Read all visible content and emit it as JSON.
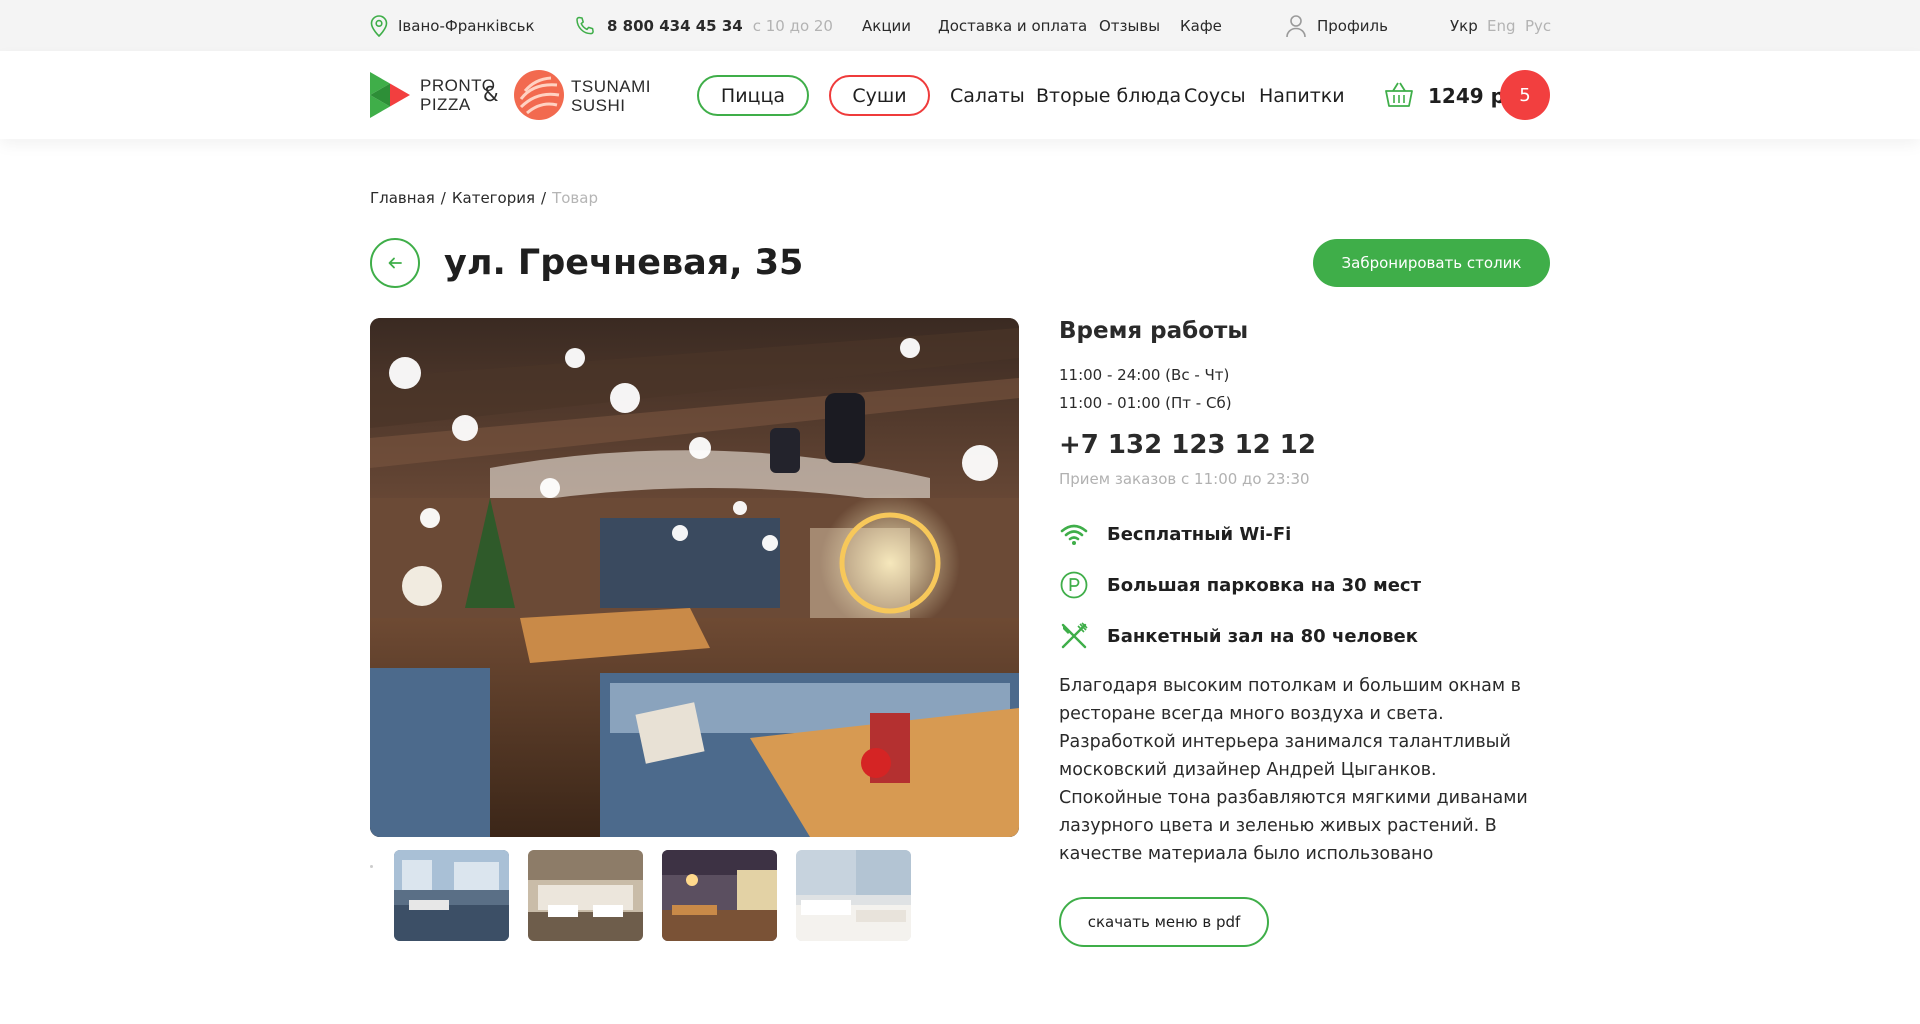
{
  "topbar": {
    "city": "Івано-Франківськ",
    "phone": "8 800 434 45 34",
    "phone_hours": "с 10 до 20",
    "links": [
      "Акции",
      "Доставка и оплата",
      "Отзывы",
      "Кафе"
    ],
    "profile": "Профиль",
    "languages": [
      {
        "label": "Укр",
        "active": true
      },
      {
        "label": "Eng",
        "active": false
      },
      {
        "label": "Рус",
        "active": false
      }
    ]
  },
  "header": {
    "brand1": {
      "line1": "PRONTO",
      "line2": "PIZZA"
    },
    "ampersand": "&",
    "brand2": {
      "line1": "TSUNAMI",
      "line2": "SUSHI"
    },
    "nav": [
      "Пицца",
      "Суши",
      "Салаты",
      "Вторые блюда",
      "Соусы",
      "Напитки"
    ],
    "cart_total": "1249 р",
    "cart_count": "5"
  },
  "breadcrumb": {
    "items": [
      "Главная",
      "Категория"
    ],
    "current": "Товар",
    "separator": "/"
  },
  "page": {
    "title": "ул. Гречневая, 35",
    "book_button": "Забронировать столик"
  },
  "info": {
    "hours_title": "Время работы",
    "hours": [
      "11:00 - 24:00 (Вс - Чт)",
      "11:00 - 01:00 (Пт - Сб)"
    ],
    "phone": "+7 132 123 12 12",
    "orders_note": "Прием заказов с 11:00 до 23:30",
    "features": [
      {
        "icon": "wifi-icon",
        "label": "Бесплатный Wi-Fi"
      },
      {
        "icon": "parking-icon",
        "label": "Большая парковка на 30 мест"
      },
      {
        "icon": "cutlery-icon",
        "label": "Банкетный зал на 80 человек"
      }
    ],
    "description": "Благодаря высоким потолкам и большим окнам в ресторане всегда много воздуха и света. Разработкой интерьера занимался талантливый московский дизайнер Андрей Цыганков. Спокойные тона разбавляются мягкими диванами лазурного цвета и зеленью живых растений. В качестве материала было использовано натуральное дерево, что делает интерьер",
    "pdf_button": "скачать меню в pdf"
  },
  "colors": {
    "accent_green": "#3fae49",
    "accent_red": "#f23f3f",
    "muted": "#b3b3b3",
    "topbar_bg": "#f4f4f4"
  }
}
